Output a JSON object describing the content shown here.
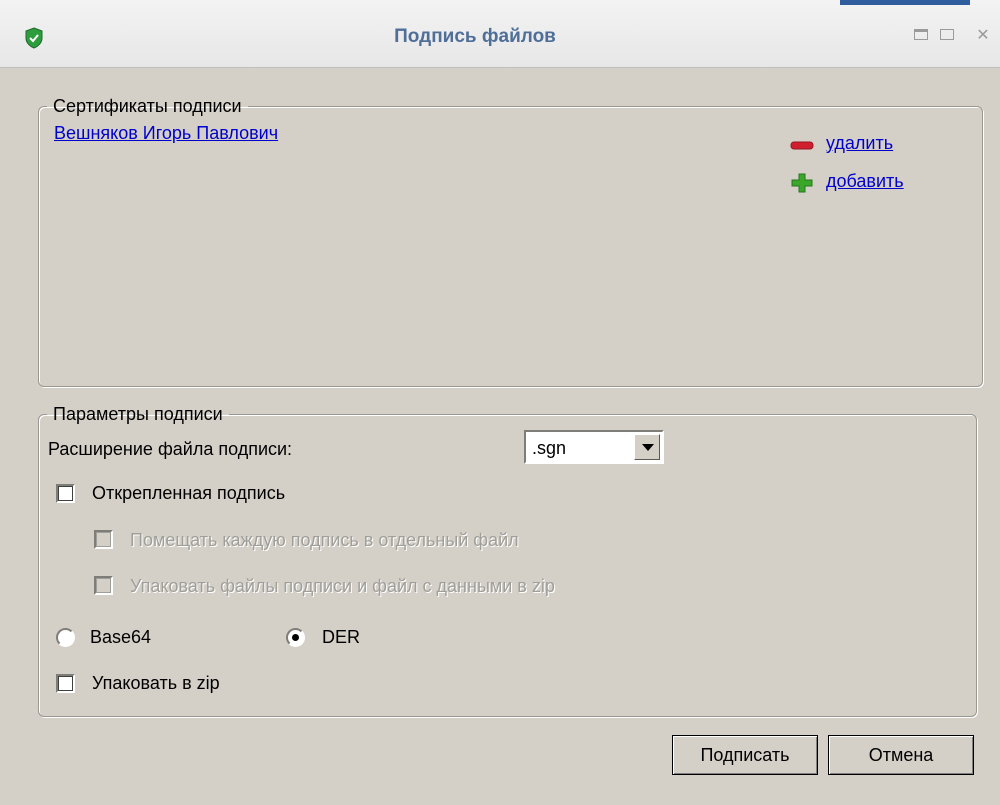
{
  "window": {
    "title": "Подпись файлов"
  },
  "certificates": {
    "legend": "Сертификаты подписи",
    "items": [
      {
        "name": "Вешняков Игорь Павлович"
      }
    ],
    "delete_label": "удалить",
    "add_label": "добавить"
  },
  "params": {
    "legend": "Параметры подписи",
    "extension_label": "Расширение файла подписи:",
    "extension_value": ".sgn",
    "detached_label": "Открепленная подпись",
    "detached_checked": false,
    "separate_files_label": "Помещать каждую подпись в отдельный файл",
    "pack_with_data_label": "Упаковать файлы подписи и файл с данными в zip",
    "encoding_options": [
      "Base64",
      "DER"
    ],
    "encoding_selected": "DER",
    "pack_zip_label": "Упаковать в zip",
    "pack_zip_checked": false
  },
  "buttons": {
    "sign": "Подписать",
    "cancel": "Отмена"
  },
  "icons": {
    "app": "shield-icon",
    "delete": "minus-icon",
    "add": "plus-icon"
  },
  "colors": {
    "title_text": "#4f6f99",
    "link": "#0000cc",
    "dialog_bg": "#d4d0c8",
    "delete_icon": "#d02030",
    "add_icon": "#3aa62a",
    "shield": "#2e9d3e"
  }
}
